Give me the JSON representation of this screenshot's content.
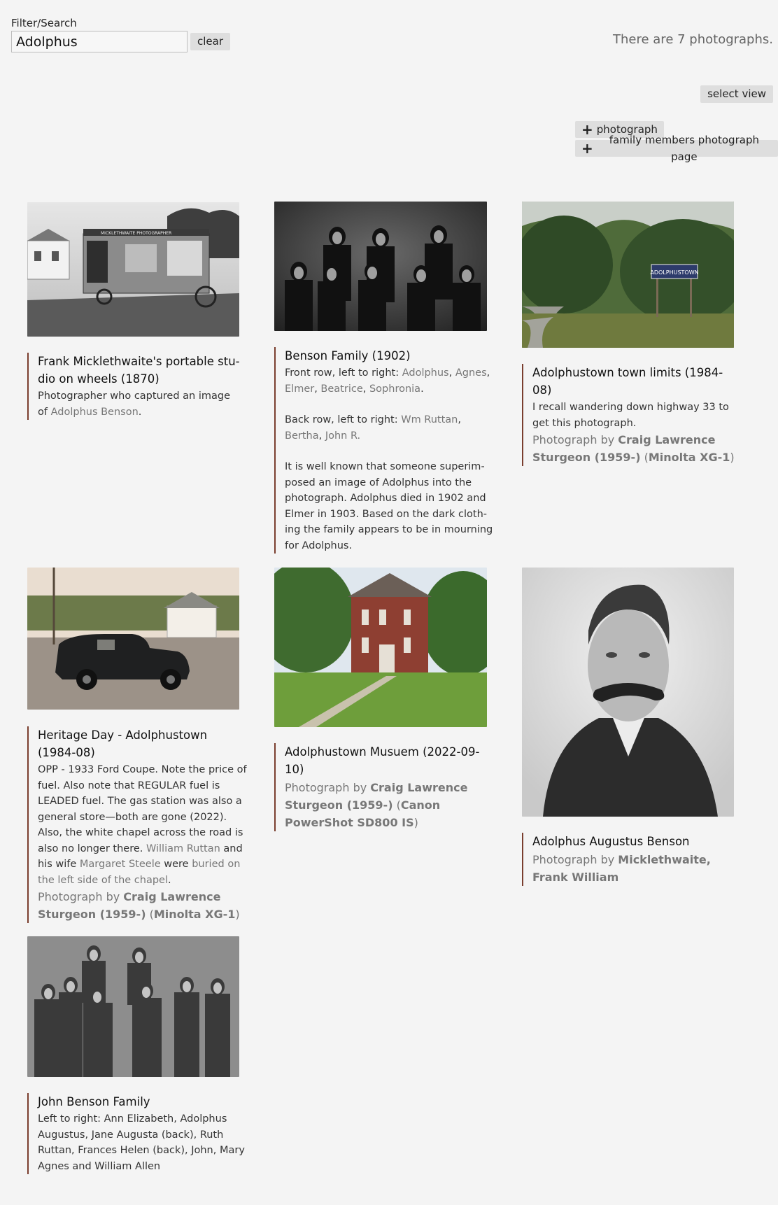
{
  "filter": {
    "label": "Filter/Search",
    "value": "Adolphus",
    "clear_label": "clear"
  },
  "count_text": "There are 7 photographs.",
  "select_view_label": "select view",
  "add_buttons": {
    "photograph": "photograph",
    "family_page": "family members photograph page"
  },
  "photos": [
    {
      "title": "Frank Micklethwaite's portable stu­dio on wheels (1870)",
      "body_text": "Photographer who captured an image of ",
      "body_link": "Adolphus Benson",
      "body_end": "."
    },
    {
      "title": "Benson Family (1902)",
      "front_prefix": "Front row, left to right: ",
      "front_names": [
        "Adolphus",
        "Agnes",
        "Elmer",
        "Beatrice",
        "Sophronia"
      ],
      "back_prefix": "Back row, left to right: ",
      "back_names": [
        "Wm Ruttan",
        "Bertha",
        "John R."
      ],
      "note": "It is well known that someone superim­posed an image of Adolphus into the photograph. Adolphus died in 1902 and Elmer in 1903. Based on the dark cloth­ing the family appears to be in mourning for Adolphus."
    },
    {
      "title": "Adolphustown town limits (1984-08)",
      "body": "I recall wandering down highway 33 to get this photograph.",
      "credit_prefix": "Photograph by ",
      "credit_name": "Craig Lawrence Sturgeon (1959-)",
      "credit_camera": "Minolta XG-1"
    },
    {
      "title": "Heritage Day - Adolphustown (1984-08)",
      "body_a": "OPP - 1933 Ford Coupe. Note the price of fuel. Also note that REGULAR fuel is LEADED fuel. The gas station was also a general store—both are gone (2022). Also, the white chapel across the road is also no longer there. ",
      "link_1": "William Ruttan",
      "body_b": " and his wife ",
      "link_2": "Margaret Steele",
      "body_c": " were ",
      "link_3": "buried on the left side of the chapel",
      "body_d": ".",
      "credit_prefix": "Photograph by ",
      "credit_name": "Craig Lawrence Sturgeon (1959-)",
      "credit_camera": "Minolta XG-1"
    },
    {
      "title": "Adolphustown Musuem (2022-09-10)",
      "credit_prefix": "Photograph by ",
      "credit_name": "Craig Lawrence Sturgeon (1959-)",
      "credit_camera": "Canon PowerShot SD800 IS"
    },
    {
      "title": "Adolphus Augustus Benson",
      "credit_prefix": "Photograph by ",
      "credit_name": "Micklethwaite, Frank William"
    },
    {
      "title": "John Benson Family",
      "body": "Left to right: Ann Elizabeth, Adolphus Augustus, Jane Augusta (back), Ruth Ruttan, Frances Helen (back), John, Mary Agnes and William Allen"
    }
  ],
  "sign_text": "ADOLPHUSTOWN",
  "wagon_sign_text": "MICKLETHWAITE PHOTOGRAPHER"
}
